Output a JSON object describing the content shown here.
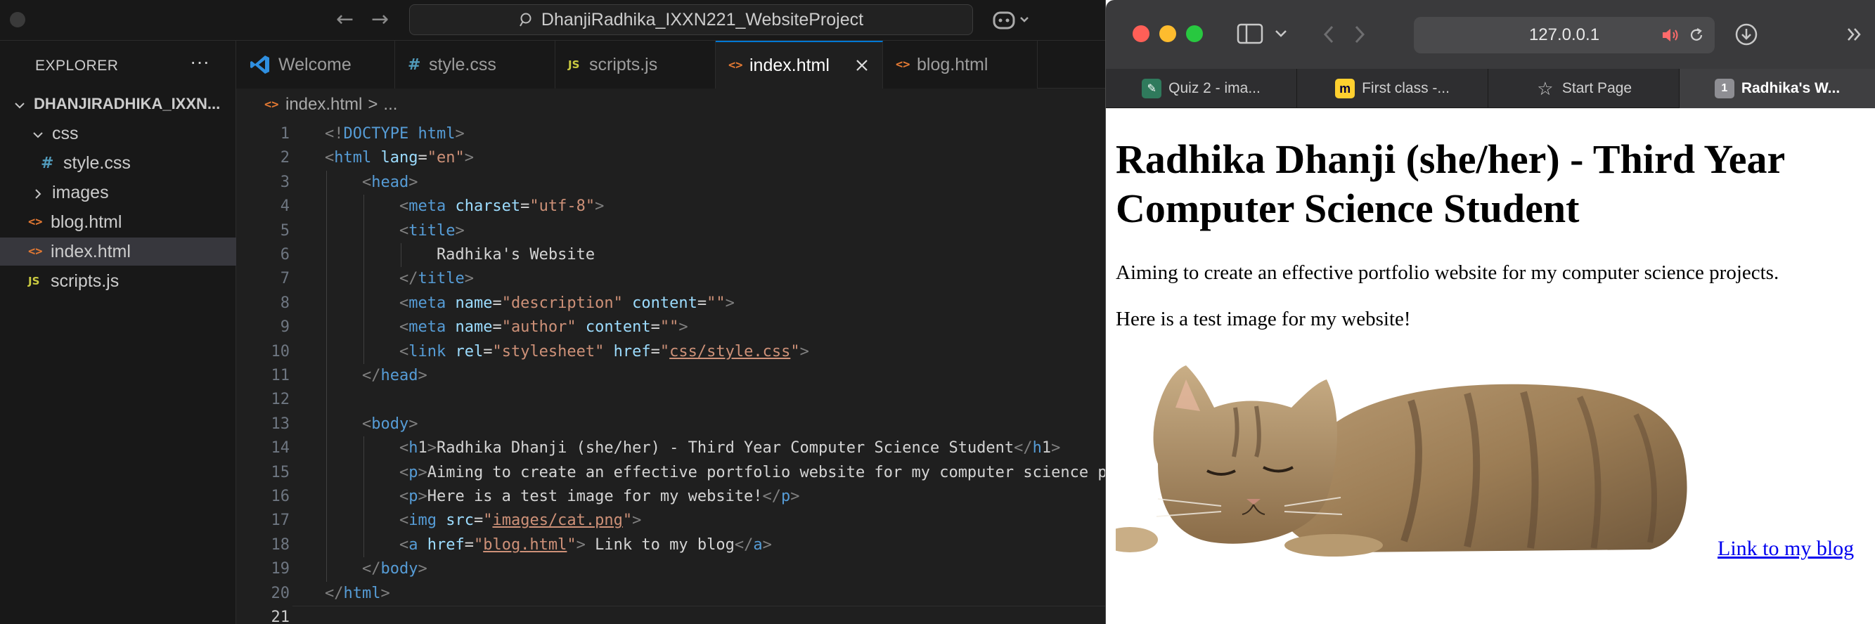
{
  "vscode": {
    "search_text": "DhanjiRadhika_IXXN221_WebsiteProject",
    "explorer": {
      "title": "EXPLORER",
      "more": "···",
      "project": "DHANJIRADHIKA_IXXN...",
      "items": [
        {
          "label": "css",
          "type": "folder",
          "open": true
        },
        {
          "label": "style.css",
          "type": "css"
        },
        {
          "label": "images",
          "type": "folder",
          "open": false
        },
        {
          "label": "blog.html",
          "type": "html"
        },
        {
          "label": "index.html",
          "type": "html",
          "selected": true
        },
        {
          "label": "scripts.js",
          "type": "js"
        }
      ]
    },
    "tabs": [
      {
        "label": "Welcome",
        "icon": "vscode-logo-icon"
      },
      {
        "label": "style.css",
        "icon": "css-file-icon"
      },
      {
        "label": "scripts.js",
        "icon": "js-file-icon"
      },
      {
        "label": "index.html",
        "icon": "html-file-icon",
        "active": true
      },
      {
        "label": "blog.html",
        "icon": "html-file-icon"
      }
    ],
    "breadcrumb": {
      "file": "index.html",
      "sep": ">",
      "rest": "..."
    },
    "code_lines": [
      {
        "n": "1",
        "text": "<!DOCTYPE html>"
      },
      {
        "n": "2",
        "text": "<html lang=\"en\">"
      },
      {
        "n": "3",
        "text": "    <head>"
      },
      {
        "n": "4",
        "text": "        <meta charset=\"utf-8\">"
      },
      {
        "n": "5",
        "text": "        <title>"
      },
      {
        "n": "6",
        "text": "            Radhika's Website"
      },
      {
        "n": "7",
        "text": "        </title>"
      },
      {
        "n": "8",
        "text": "        <meta name=\"description\" content=\"\">"
      },
      {
        "n": "9",
        "text": "        <meta name=\"author\" content=\"\">"
      },
      {
        "n": "10",
        "text": "        <link rel=\"stylesheet\" href=\"css/style.css\">"
      },
      {
        "n": "11",
        "text": "    </head>"
      },
      {
        "n": "12",
        "text": ""
      },
      {
        "n": "13",
        "text": "    <body>"
      },
      {
        "n": "14",
        "text": "        <h1>Radhika Dhanji (she/her) - Third Year Computer Science Student</h1>"
      },
      {
        "n": "15",
        "text": "        <p>Aiming to create an effective portfolio website for my computer science projects.</p>"
      },
      {
        "n": "16",
        "text": "        <p>Here is a test image for my website!</p>"
      },
      {
        "n": "17",
        "text": "        <img src=\"images/cat.png\">"
      },
      {
        "n": "18",
        "text": "        <a href=\"blog.html\"> Link to my blog</a>"
      },
      {
        "n": "19",
        "text": "    </body>"
      },
      {
        "n": "20",
        "text": "</html>"
      },
      {
        "n": "21",
        "text": ""
      }
    ],
    "current_line": "21"
  },
  "browser": {
    "url": "127.0.0.1",
    "tabs": [
      {
        "label": "Quiz 2 - ima...",
        "icon": "quiz-favicon-icon"
      },
      {
        "label": "First class -...",
        "icon": "miro-favicon-icon"
      },
      {
        "label": "Start Page",
        "icon": "star-icon"
      },
      {
        "label": "Radhika's W...",
        "icon": "page-number-favicon-icon",
        "badge": "1",
        "active": true
      }
    ],
    "page": {
      "h1": "Radhika Dhanji (she/her) - Third Year Computer Science Student",
      "p1": "Aiming to create an effective portfolio website for my computer science projects.",
      "p2": "Here is a test image for my website!",
      "image": "sleeping-cat-image",
      "link": "Link to my blog"
    }
  },
  "colors": {
    "vscode_bg": "#1f1f1f",
    "vscode_sidebar": "#181818",
    "accent": "#0078d4",
    "tag": "#569cd6",
    "attr": "#9cdcfe",
    "string": "#ce9178",
    "link": "#0000ee"
  }
}
